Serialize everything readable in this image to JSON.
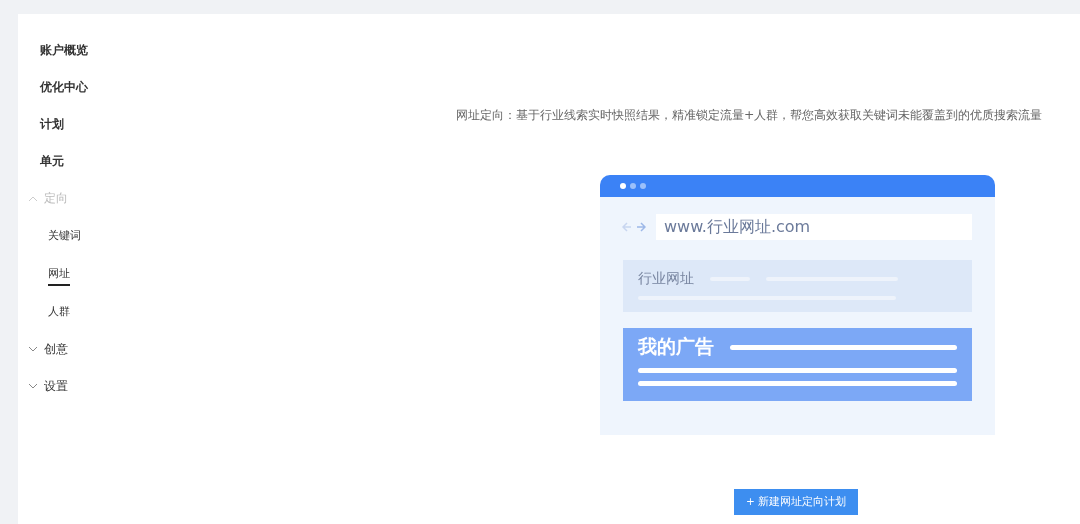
{
  "sidebar": {
    "items": [
      {
        "kind": "link",
        "label": "账户概览",
        "selected": false
      },
      {
        "kind": "link",
        "label": "优化中心",
        "selected": false
      },
      {
        "kind": "link",
        "label": "计划",
        "selected": false
      },
      {
        "kind": "link",
        "label": "单元",
        "selected": false
      },
      {
        "kind": "group",
        "label": "定向",
        "expanded": true,
        "children": [
          {
            "label": "关键词",
            "selected": false
          },
          {
            "label": "网址",
            "selected": true
          },
          {
            "label": "人群",
            "selected": false
          }
        ]
      },
      {
        "kind": "group",
        "label": "创意",
        "expanded": false
      },
      {
        "kind": "group",
        "label": "设置",
        "expanded": false
      }
    ]
  },
  "main": {
    "description": "网址定向：基于行业线索实时快照结果，精准锁定流量+人群，帮您高效获取关键词未能覆盖到的优质搜索流量",
    "illustration": {
      "url": "www.行业网址.com",
      "result_title": "行业网址",
      "ad_title": "我的广告"
    },
    "button": "+ 新建网址定向计划"
  }
}
